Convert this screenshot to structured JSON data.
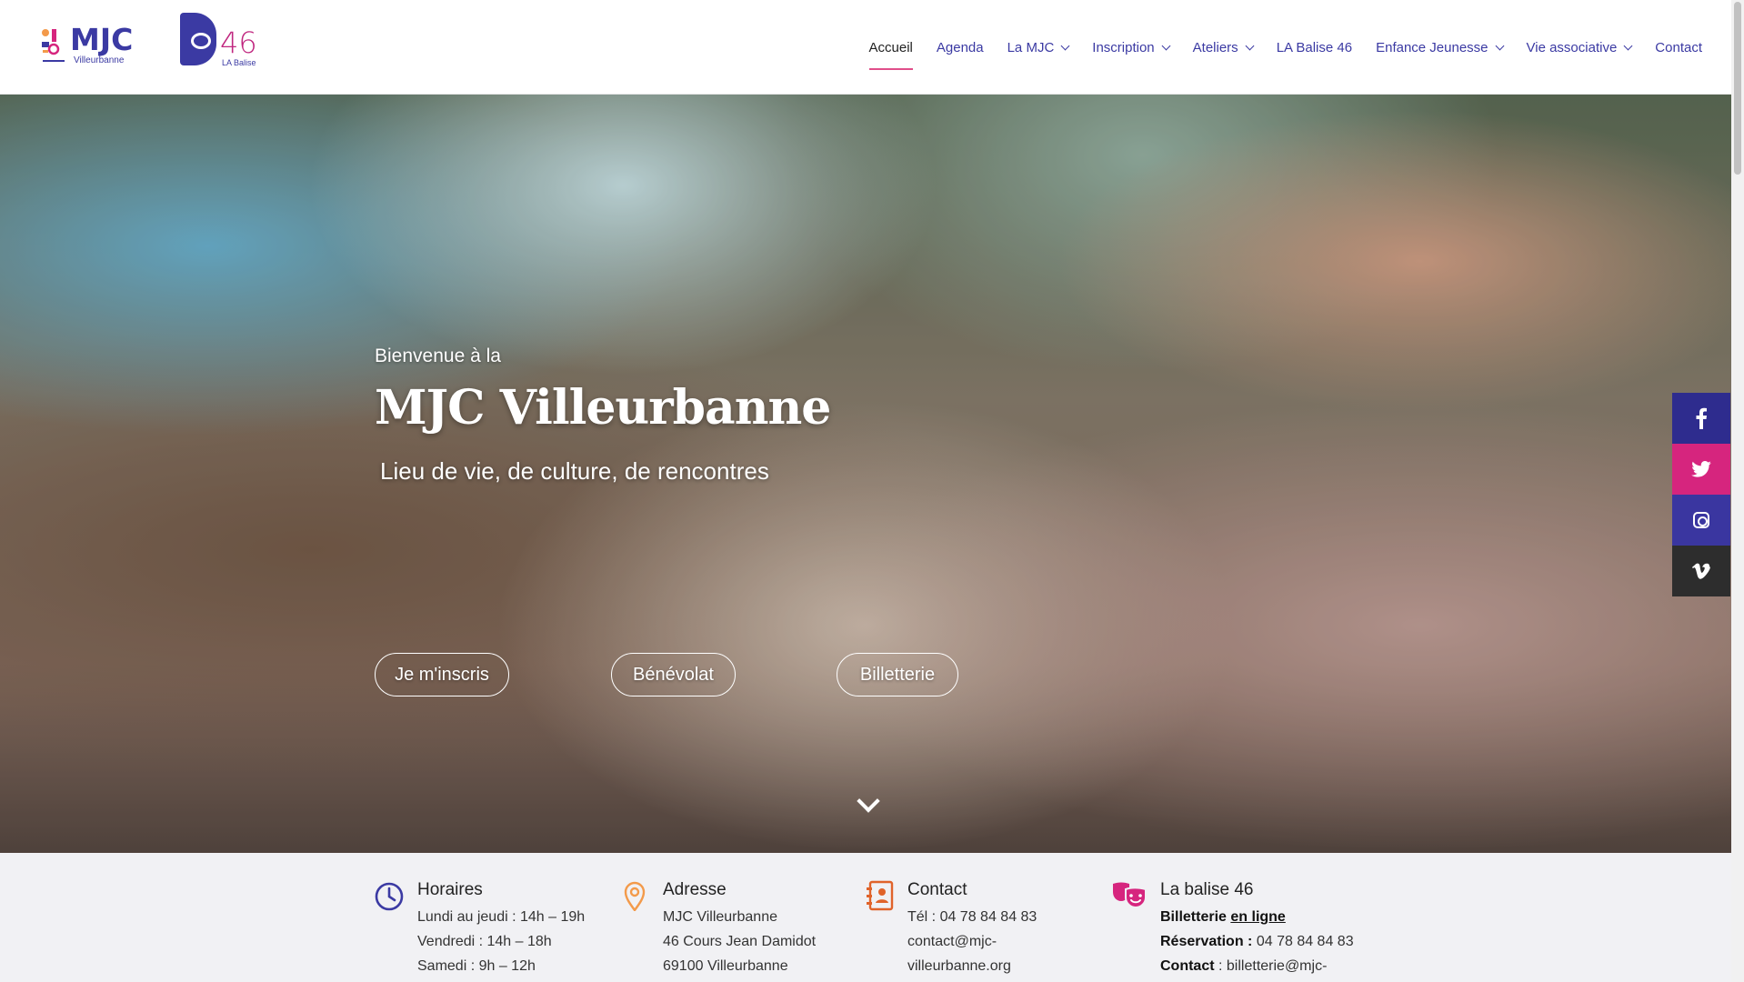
{
  "logos": {
    "mjc_word": "MJC",
    "mjc_sub": "Villeurbanne",
    "b46_num": "46",
    "b46_label": "LA Balise"
  },
  "nav": {
    "items": [
      {
        "label": "Accueil",
        "dropdown": false,
        "active": true
      },
      {
        "label": "Agenda",
        "dropdown": false
      },
      {
        "label": "La MJC",
        "dropdown": true
      },
      {
        "label": "Inscription",
        "dropdown": true
      },
      {
        "label": "Ateliers",
        "dropdown": true
      },
      {
        "label": "LA Balise 46",
        "dropdown": false
      },
      {
        "label": "Enfance Jeunesse",
        "dropdown": true
      },
      {
        "label": "Vie associative",
        "dropdown": true
      },
      {
        "label": "Contact",
        "dropdown": false
      }
    ]
  },
  "hero": {
    "pre": "Bienvenue à la",
    "title": "MJC Villeurbanne",
    "subtitle": "Lieu de vie, de culture, de rencontres",
    "buttons": [
      "Je m'inscris",
      "Bénévolat",
      "Billetterie"
    ]
  },
  "social": {
    "icons": [
      "facebook-icon",
      "twitter-icon",
      "instagram-icon",
      "vimeo-icon"
    ],
    "colors": {
      "facebook": "#2e2c8e",
      "twitter": "#d6257e",
      "instagram": "#3a36a0",
      "vimeo": "#2d2d2d"
    }
  },
  "info": {
    "horaires": {
      "title": "Horaires",
      "lines": [
        "Lundi au jeudi : 14h – 19h",
        "Vendredi : 14h – 18h",
        "Samedi : 9h – 12h"
      ]
    },
    "adresse": {
      "title": "Adresse",
      "lines": [
        "MJC Villeurbanne",
        "46 Cours Jean Damidot",
        "69100 Villeurbanne"
      ]
    },
    "contact": {
      "title": "Contact",
      "lines": [
        "Tél : 04 78 84 84 83",
        "contact@mjc-",
        "villeurbanne.org"
      ]
    },
    "balise": {
      "title": "La balise 46",
      "billetterie_label": "Billetterie",
      "billetterie_link": "en ligne",
      "reservation_label": "Réservation :",
      "reservation_value": "04 78 84 84 83",
      "contact_label": "Contact",
      "contact_value": ": billetterie@mjc-"
    }
  },
  "colors": {
    "brand_primary": "#3b3aa3",
    "brand_accent": "#e04f8a",
    "icon_orange": "#f39a4a",
    "icon_purple": "#3b3aa3",
    "icon_pink": "#d6257e"
  }
}
